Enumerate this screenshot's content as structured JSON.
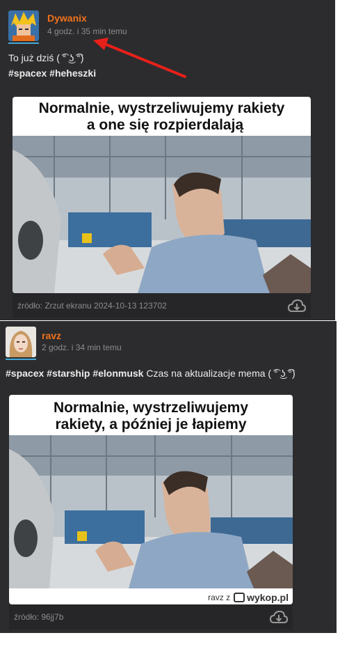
{
  "posts": [
    {
      "username": "Dywanix",
      "timestamp": "4 godz. i 35 min temu",
      "text": "To już dziś ( ͡° ͜ʖ ͡°)",
      "tags": [
        "#spacex",
        "#heheszki"
      ],
      "meme_caption_line1": "Normalnie, wystrzeliwujemy rakiety",
      "meme_caption_line2": "a one się rozpierdalają",
      "source": "źródło: Zrzut ekranu 2024-10-13 123702"
    },
    {
      "username": "ravz",
      "timestamp": "2 godz. i 34 min temu",
      "tags": [
        "#spacex",
        "#starship",
        "#elonmusk"
      ],
      "text": "Czas na aktualizacje mema ( ͡° ͜ʖ ͡°)",
      "meme_caption_line1": "Normalnie, wystrzeliwujemy",
      "meme_caption_line2": "rakiety, a później je łapiemy",
      "watermark_prefix": "ravz z",
      "watermark_brand": "wykop.pl",
      "source": "źródło: 96jj7b"
    }
  ],
  "colors": {
    "background": "#2c2c2e",
    "username": "#f2721b",
    "annotation_arrow": "#e8201a"
  },
  "icons": [
    "download-cloud-icon",
    "annotation-arrow"
  ]
}
